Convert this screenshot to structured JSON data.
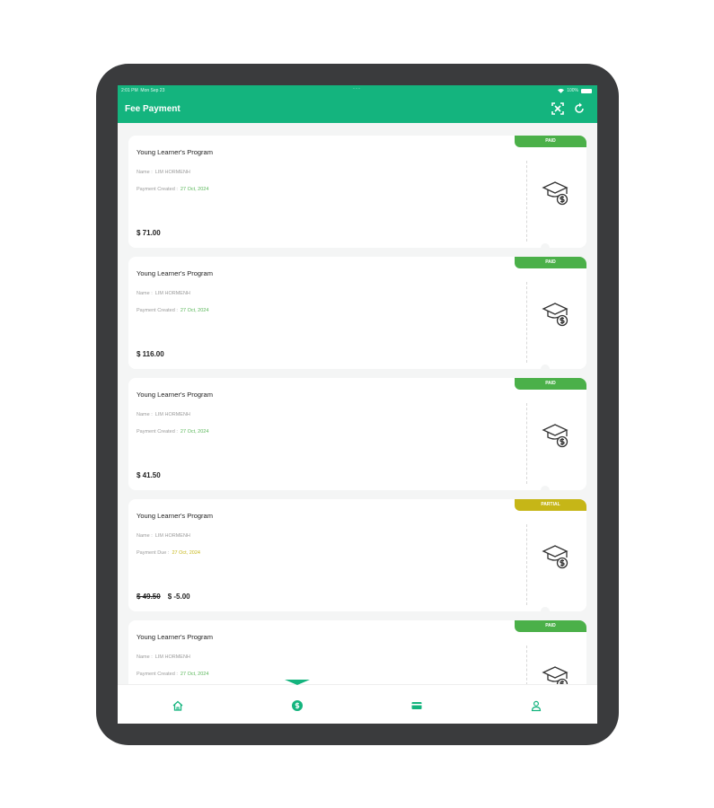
{
  "status_bar": {
    "time": "2:01 PM",
    "date": "Mon Sep 23",
    "center_dots": "···",
    "battery": "100%"
  },
  "app_bar": {
    "title": "Fee Payment",
    "icons": [
      "qr-scan-icon",
      "refresh-icon"
    ]
  },
  "colors": {
    "primary": "#14b47e",
    "paid": "#4bb049",
    "partial": "#c6b617",
    "date_paid": "#5cb85c"
  },
  "payments": [
    {
      "program": "Young Learner's Program",
      "name_label": "Name :",
      "name": "LIM HORMENH",
      "date_label": "Payment Created :",
      "date": "27 Oct, 2024",
      "amount": "$ 71.00",
      "status": "PAID",
      "icon": "graduation-cap-dollar-icon"
    },
    {
      "program": "Young Learner's Program",
      "name_label": "Name :",
      "name": "LIM HORMENH",
      "date_label": "Payment Created :",
      "date": "27 Oct, 2024",
      "amount": "$ 116.00",
      "status": "PAID",
      "icon": "graduation-cap-dollar-icon"
    },
    {
      "program": "Young Learner's Program",
      "name_label": "Name :",
      "name": "LIM HORMENH",
      "date_label": "Payment Created :",
      "date": "27 Oct, 2024",
      "amount": "$ 41.50",
      "status": "PAID",
      "icon": "graduation-cap-dollar-icon"
    },
    {
      "program": "Young Learner's Program",
      "name_label": "Name :",
      "name": "LIM HORMENH",
      "date_label": "Payment Due :",
      "date": "27 Oct, 2024",
      "amount_original": "$ 49.50",
      "amount": "$ -5.00",
      "status": "PARTIAL",
      "icon": "graduation-cap-dollar-icon"
    },
    {
      "program": "Young Learner's Program",
      "name_label": "Name :",
      "name": "LIM HORMENH",
      "date_label": "Payment Created :",
      "date": "27 Oct, 2024",
      "status": "PAID",
      "icon": "graduation-cap-dollar-icon"
    }
  ],
  "bottom_nav": {
    "items": [
      "home-icon",
      "fee-payment-icon",
      "card-icon",
      "profile-icon"
    ],
    "active": "fee-payment-icon"
  }
}
